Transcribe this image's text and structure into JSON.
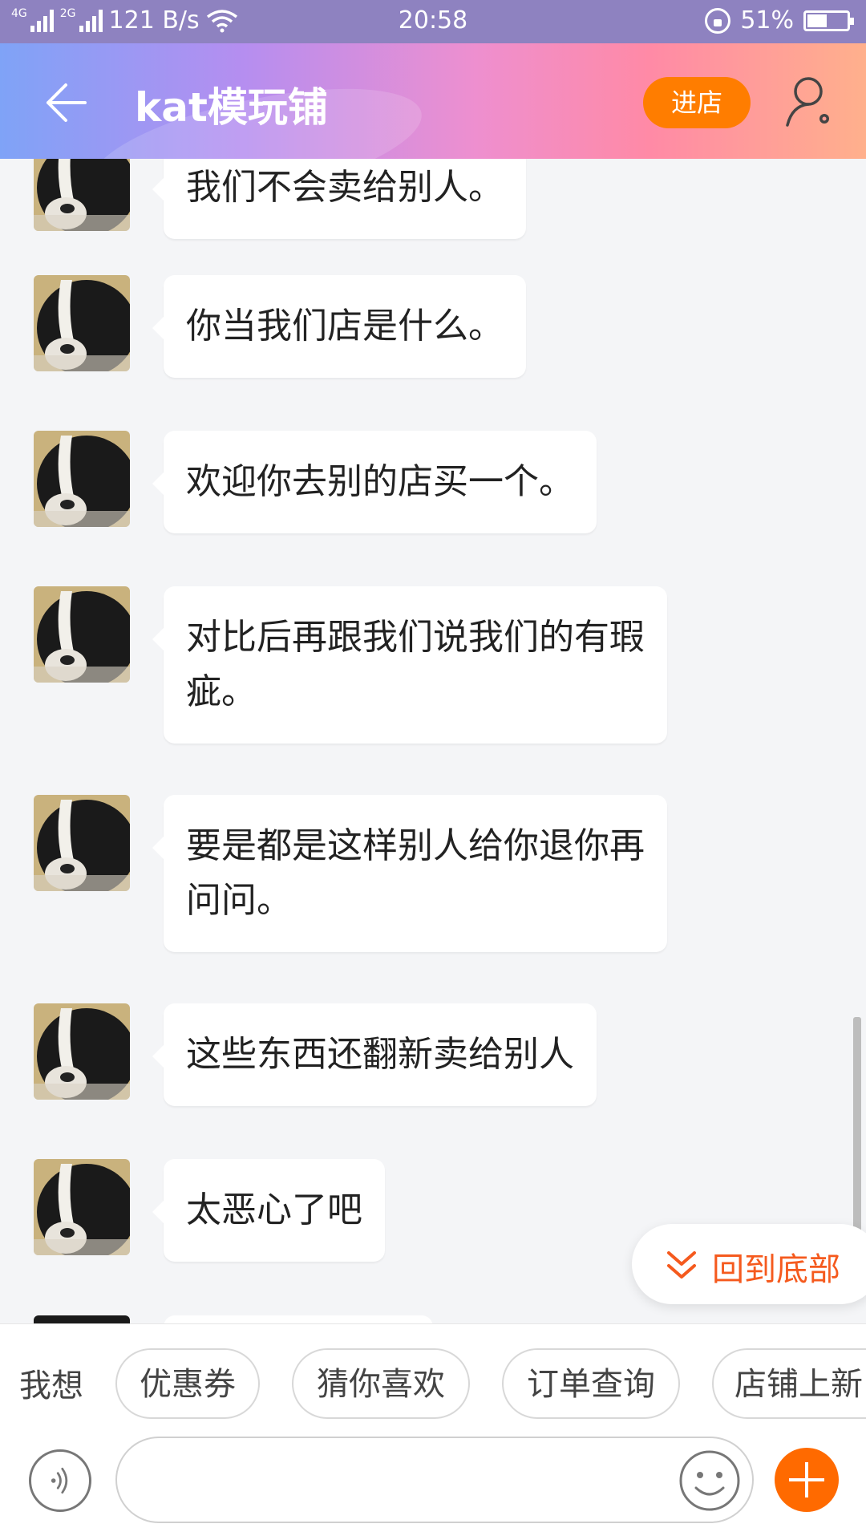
{
  "status_bar": {
    "net_left": "4G",
    "net_right": "2G",
    "speed": "121 B/s",
    "time": "20:58",
    "battery": "51%",
    "battery_level": 0.51
  },
  "header": {
    "title": "kat模玩铺",
    "enter_store": "进店",
    "icons": [
      "back-arrow-icon",
      "user-settings-icon"
    ]
  },
  "messages": [
    {
      "lines": [
        "我们不会卖给别人。"
      ]
    },
    {
      "lines": [
        "你当我们店是什么。"
      ]
    },
    {
      "lines": [
        "欢迎你去别的店买一个。"
      ]
    },
    {
      "lines": [
        "对比后再跟我们说我们的有瑕",
        "疵。"
      ]
    },
    {
      "lines": [
        "要是都是这样别人给你退你再",
        "问问。"
      ]
    },
    {
      "lines": [
        "这些东西还翻新卖给别人"
      ]
    },
    {
      "lines": [
        "太恶心了吧"
      ]
    }
  ],
  "back_to_bottom": "回到底部",
  "quick_replies": {
    "label": "我想",
    "chips": [
      "优惠券",
      "猜你喜欢",
      "订单查询",
      "店铺上新"
    ]
  },
  "composer": {
    "input_value": "",
    "icons": [
      "voice-icon",
      "emoji-icon",
      "plus-icon"
    ]
  },
  "colors": {
    "status_bar": "#8e82c0",
    "accent_orange": "#ff7d00",
    "back_bottom_text": "#f55a1e",
    "chat_bg": "#f4f5f7"
  }
}
